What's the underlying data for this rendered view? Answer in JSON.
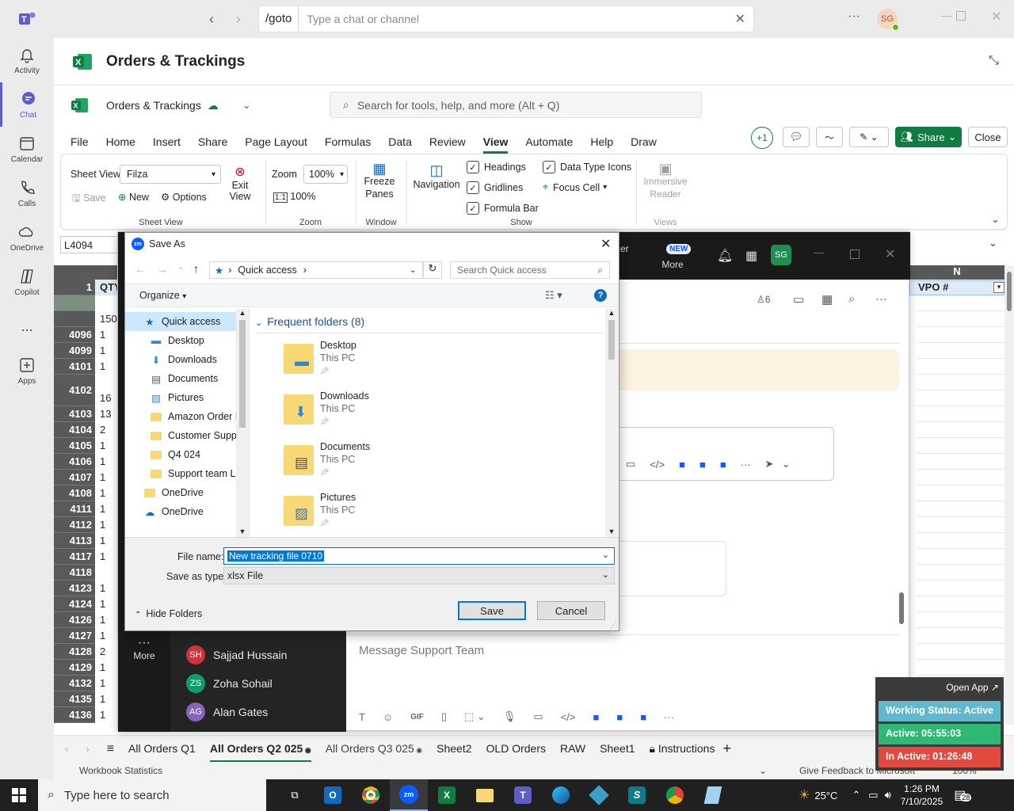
{
  "teams": {
    "search_prefix": "/goto",
    "search_placeholder": "Type a chat or channel",
    "avatar": "SG",
    "rail": [
      {
        "label": "Activity"
      },
      {
        "label": "Chat"
      },
      {
        "label": "Calendar"
      },
      {
        "label": "Calls"
      },
      {
        "label": "OneDrive"
      },
      {
        "label": "Copilot"
      },
      {
        "label": "..."
      },
      {
        "label": "Apps"
      }
    ]
  },
  "excel": {
    "app_title": "Orders & Trackings",
    "file_name": "Orders & Trackings",
    "search_placeholder": "Search for tools, help, and more (Alt + Q)",
    "menu": [
      "File",
      "Home",
      "Insert",
      "Share",
      "Page Layout",
      "Formulas",
      "Data",
      "Review",
      "View",
      "Automate",
      "Help",
      "Draw"
    ],
    "active_menu": "View",
    "plus_one": "+1",
    "share_label": "Share",
    "close_label": "Close",
    "ribbon": {
      "sheet_view_label": "Sheet View",
      "sheet_view_value": "Filza",
      "save": "Save",
      "new": "New",
      "options": "Options",
      "exit_view": "Exit View",
      "group_sheet_view": "Sheet View",
      "zoom_label": "Zoom",
      "zoom_value": "100%",
      "zoom_100": "100%",
      "group_zoom": "Zoom",
      "freeze": "Freeze Panes",
      "group_window": "Window",
      "navigation": "Navigation",
      "headings": "Headings",
      "gridlines": "Gridlines",
      "formula_bar": "Formula Bar",
      "data_type_icons": "Data Type Icons",
      "focus_cell": "Focus Cell",
      "group_show": "Show",
      "immersive": "Immersive Reader",
      "group_views": "Views"
    },
    "name_box": "L4094",
    "col_n": "N",
    "vpo_header": "VPO #",
    "qty_header": "QTY",
    "rows": [
      {
        "n": "1",
        "q": "QTY"
      },
      {
        "n": "",
        "q": ""
      },
      {
        "n": "",
        "q": "150"
      },
      {
        "n": "4096",
        "q": "1"
      },
      {
        "n": "4099",
        "q": "1"
      },
      {
        "n": "4101",
        "q": "1"
      },
      {
        "n": "4102",
        "q": "16"
      },
      {
        "n": "4103",
        "q": "13"
      },
      {
        "n": "4104",
        "q": "2"
      },
      {
        "n": "4105",
        "q": "1"
      },
      {
        "n": "4106",
        "q": "1"
      },
      {
        "n": "4107",
        "q": "1"
      },
      {
        "n": "4108",
        "q": "1"
      },
      {
        "n": "4111",
        "q": "1"
      },
      {
        "n": "4112",
        "q": "1"
      },
      {
        "n": "4113",
        "q": "1"
      },
      {
        "n": "4117",
        "q": "1"
      },
      {
        "n": "4118",
        "q": ""
      },
      {
        "n": "4123",
        "q": "1"
      },
      {
        "n": "4124",
        "q": "1"
      },
      {
        "n": "4126",
        "q": "1"
      },
      {
        "n": "4127",
        "q": "1"
      },
      {
        "n": "4128",
        "q": "2"
      },
      {
        "n": "4129",
        "q": "1"
      },
      {
        "n": "4132",
        "q": "1"
      },
      {
        "n": "4135",
        "q": "1"
      },
      {
        "n": "4136",
        "q": "1"
      }
    ],
    "sheets": [
      "All Orders Q1",
      "All Orders Q2 025",
      "All Orders Q3 025",
      "Sheet2",
      "OLD Orders",
      "RAW",
      "Sheet1",
      "Instructions"
    ],
    "active_sheet": "All Orders Q2 025",
    "status_left": "Workbook Statistics",
    "status_feedback": "Give Feedback to Microsoft",
    "status_zoom": "100%"
  },
  "zoom": {
    "new_badge": "NEW",
    "more": "More",
    "avatar": "SG",
    "participants": "6",
    "message_placeholder": "Message Support Team",
    "more_label": "More",
    "members": [
      {
        "initials": "SH",
        "name": "Sajjad Hussain",
        "color": "#d13438"
      },
      {
        "initials": "ZS",
        "name": "Zoha Sohail",
        "color": "#0e9d6e"
      },
      {
        "initials": "AG",
        "name": "Alan Gates",
        "color": "#8764b8"
      }
    ]
  },
  "status_widget": {
    "open_app": "Open App ↗",
    "working": "Working Status: Active",
    "active": "Active: 05:55:03",
    "inactive": "In Active: 01:26:48"
  },
  "dialog": {
    "title": "Save As",
    "app_icon": "zm",
    "location": "Quick access",
    "search_placeholder": "Search Quick access",
    "organize": "Organize",
    "nav": [
      {
        "label": "Quick access",
        "type": "star"
      },
      {
        "label": "Desktop",
        "type": "desktop",
        "pin": true
      },
      {
        "label": "Downloads",
        "type": "download",
        "pin": true
      },
      {
        "label": "Documents",
        "type": "doc",
        "pin": true
      },
      {
        "label": "Pictures",
        "type": "pic",
        "pin": true
      },
      {
        "label": "Amazon Order P",
        "type": "folder"
      },
      {
        "label": "Customer Suppc",
        "type": "folder"
      },
      {
        "label": "Q4 024",
        "type": "folder"
      },
      {
        "label": "Support team Lc",
        "type": "folder"
      },
      {
        "label": "OneDrive",
        "type": "folder"
      },
      {
        "label": "OneDrive",
        "type": "cloud"
      }
    ],
    "section": "Frequent folders (8)",
    "folders": [
      {
        "name": "Desktop",
        "sub": "This PC"
      },
      {
        "name": "Downloads",
        "sub": "This PC"
      },
      {
        "name": "Documents",
        "sub": "This PC"
      },
      {
        "name": "Pictures",
        "sub": "This PC"
      }
    ],
    "file_name_label": "File name:",
    "file_name": "New tracking file 0710",
    "type_label": "Save as type:",
    "type_value": "xlsx File",
    "hide_folders": "Hide Folders",
    "save": "Save",
    "cancel": "Cancel"
  },
  "taskbar": {
    "search_placeholder": "Type here to search",
    "temp": "25°C",
    "time": "1:26 PM",
    "date": "7/10/2025",
    "notif": "28"
  }
}
